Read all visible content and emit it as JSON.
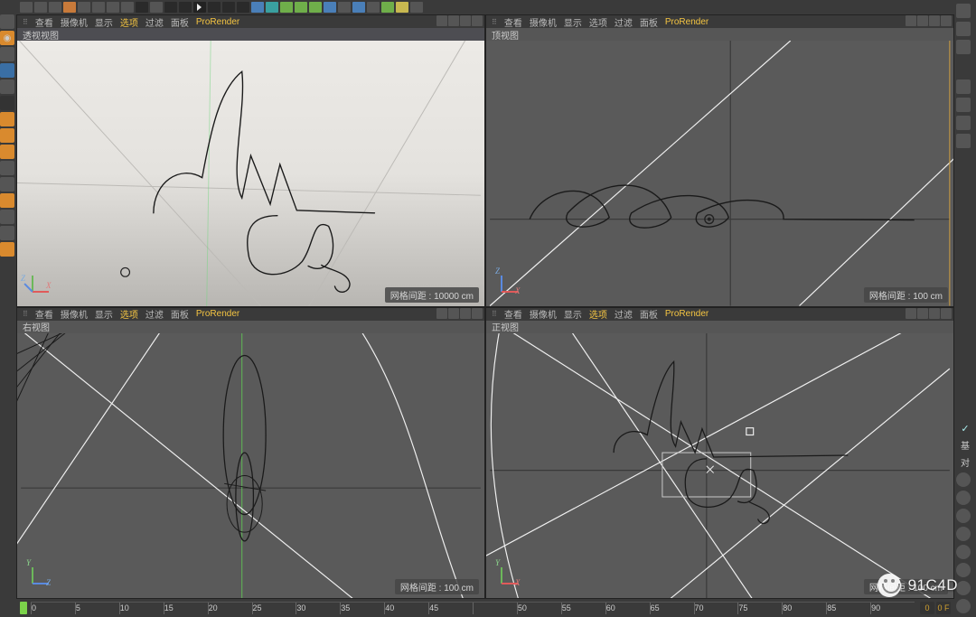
{
  "menus": {
    "m1": "查看",
    "m2": "摄像机",
    "m3": "显示",
    "m4": "选项",
    "m5": "过滤",
    "m6": "面板",
    "pro": "ProRender"
  },
  "views": {
    "persp_title": "透视视图",
    "top_title": "顶视图",
    "right_title": "右视图",
    "front_title": "正视图"
  },
  "grid": {
    "persp": "网格间距 : 10000 cm",
    "ortho": "网格间距 : 100 cm"
  },
  "axis": {
    "x": "X",
    "y": "Y",
    "z": "Z"
  },
  "timeline": {
    "ticks": [
      "0",
      "5",
      "10",
      "15",
      "20",
      "25",
      "30",
      "35",
      "40",
      "45",
      "",
      "50",
      "55",
      "60",
      "65",
      "70",
      "75",
      "80",
      "85",
      "90"
    ],
    "frame": "0",
    "fps": "0 F"
  },
  "right_panel": {
    "a": "基",
    "b": "对"
  },
  "watermark": "91C4D"
}
